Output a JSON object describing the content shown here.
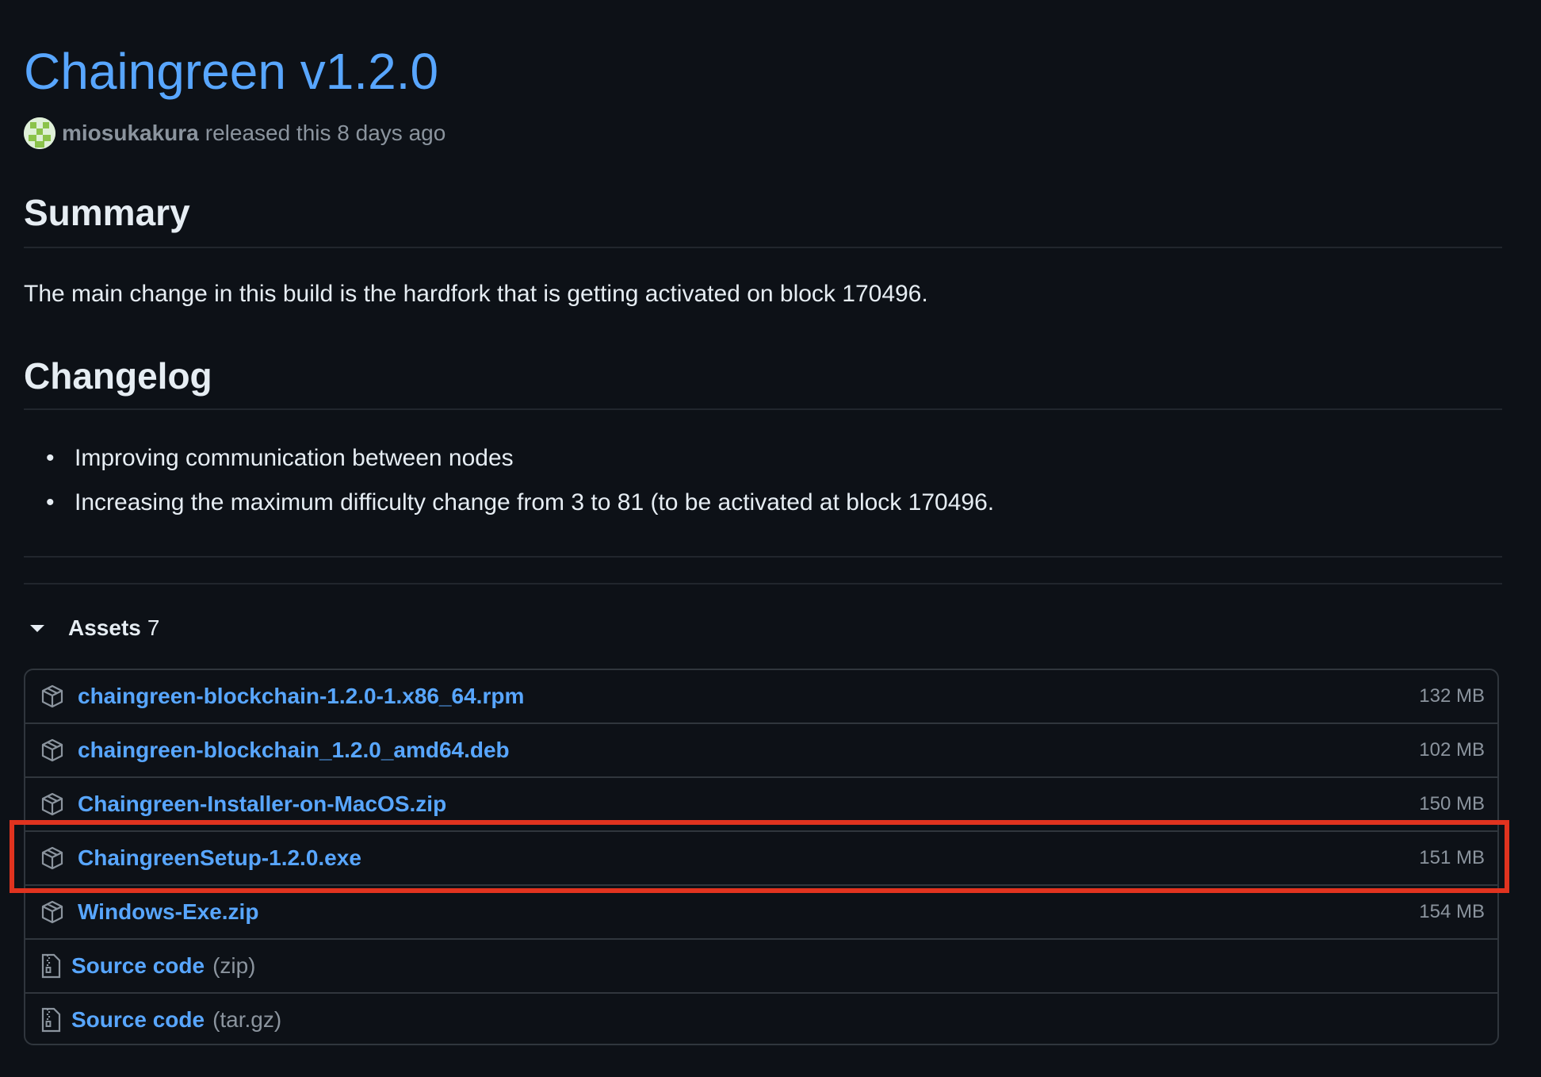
{
  "release": {
    "title": "Chaingreen v1.2.0",
    "author": "miosukakura",
    "released_text": "released this 8 days ago"
  },
  "summary": {
    "heading": "Summary",
    "text": "The main change in this build is the hardfork that is getting activated on block 170496."
  },
  "changelog": {
    "heading": "Changelog",
    "items": [
      "Improving communication between nodes",
      "Increasing the maximum difficulty change from 3 to 81 (to be activated at block 170496."
    ]
  },
  "assets": {
    "label": "Assets",
    "count": "7",
    "items": [
      {
        "name": "chaingreen-blockchain-1.2.0-1.x86_64.rpm",
        "size": "132 MB",
        "icon": "package-icon"
      },
      {
        "name": "chaingreen-blockchain_1.2.0_amd64.deb",
        "size": "102 MB",
        "icon": "package-icon"
      },
      {
        "name": "Chaingreen-Installer-on-MacOS.zip",
        "size": "150 MB",
        "icon": "package-icon"
      },
      {
        "name": "ChaingreenSetup-1.2.0.exe",
        "size": "151 MB",
        "icon": "package-icon",
        "highlighted": true
      },
      {
        "name": "Windows-Exe.zip",
        "size": "154 MB",
        "icon": "package-icon"
      },
      {
        "name": "Source code",
        "suffix": "(zip)",
        "icon": "file-zip-icon"
      },
      {
        "name": "Source code",
        "suffix": "(tar.gz)",
        "icon": "file-zip-icon"
      }
    ]
  },
  "colors": {
    "background": "#0d1117",
    "link": "#58a6ff",
    "muted": "#8b949e",
    "border": "#30363d",
    "highlight": "#e0331f"
  }
}
